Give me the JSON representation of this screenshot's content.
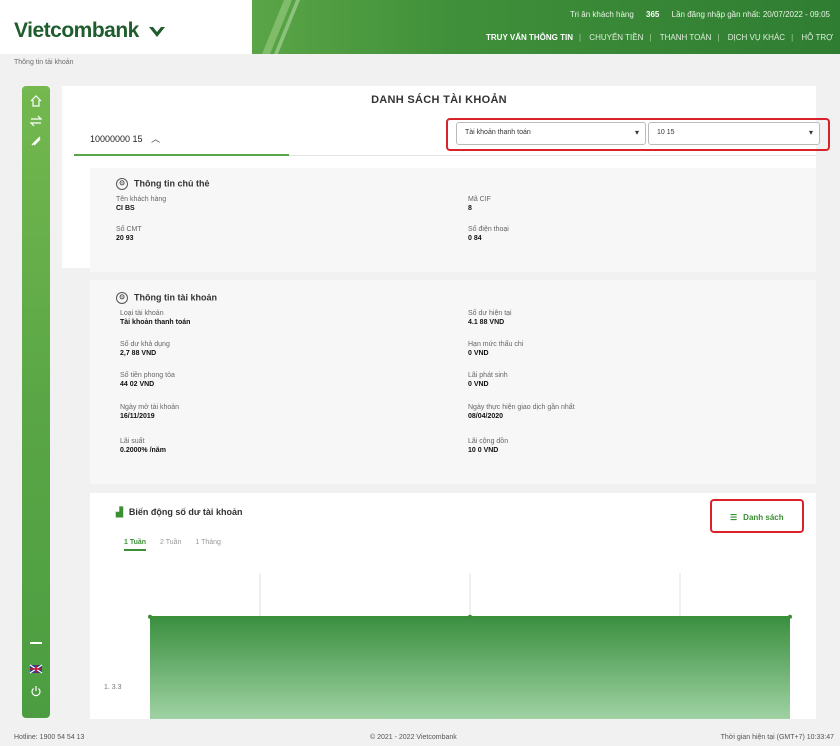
{
  "brand": {
    "name": "Vietcombank",
    "color": "#1f5d2e",
    "accent": "#5aa546"
  },
  "top_info": {
    "greeting": "Tri ân khách hàng",
    "count": "365",
    "last_login_label": "Lần đăng nhập gần nhất: 20/07/2022 - 09:05"
  },
  "nav": {
    "items": [
      "TRUY VẤN THÔNG TIN",
      "CHUYỂN TIỀN",
      "THANH TOÁN",
      "DỊCH VỤ KHÁC",
      "HỖ TRỢ"
    ]
  },
  "breadcrumb": "Thông tin tài khoản",
  "page": {
    "title": "DANH SÁCH TÀI KHOẢN",
    "account_number": "10000000 15",
    "select_type": "Tài khoản thanh toán",
    "select_account": "10          15"
  },
  "owner": {
    "heading": "Thông tin chủ thẻ",
    "name_label": "Tên khách hàng",
    "name_value": "CI              BS",
    "cif_label": "Mã CIF",
    "cif_value": "8",
    "id_label": "Số CMT",
    "id_value": "20        93",
    "phone_label": "Số điện thoại",
    "phone_value": "0          84"
  },
  "account": {
    "heading": "Thông tin tài khoản",
    "type_label": "Loại tài khoản",
    "type_value": "Tài khoản thanh toán",
    "balance_label": "Số dư hiện tại",
    "balance_value": "4.1        88 VND",
    "avail_label": "Số dư khả dụng",
    "avail_value": "2,7        88 VND",
    "limit_label": "Hạn mức thấu chi",
    "limit_value": "0 VND",
    "blocked_label": "Số tiền phong tỏa",
    "blocked_value": "44      02 VND",
    "hold_label": "Lãi phát sinh",
    "hold_value": "0 VND",
    "open_label": "Ngày mở tài khoản",
    "open_value": "16/11/2019",
    "last_txn_label": "Ngày thực hiện giao dịch gần nhất",
    "last_txn_value": "08/04/2020",
    "rate_label": "Lãi suất",
    "rate_value": "0.2000% /năm",
    "accrued_label": "Lãi cộng dồn",
    "accrued_value": "10        0 VND"
  },
  "chart": {
    "heading": "Biến động số dư tài khoản",
    "list_button": "Danh sách",
    "tabs": [
      "1 Tuần",
      "2 Tuần",
      "1 Tháng"
    ],
    "y_label": "1. 3.3"
  },
  "chart_data": {
    "type": "area",
    "x": [
      0,
      1,
      2,
      3,
      4
    ],
    "series": [
      {
        "values": [
          3.3,
          3.3,
          3.3,
          3.3,
          3.3
        ]
      }
    ],
    "grid": true
  },
  "footer": {
    "hotline": "Hotline: 1900 54 54 13",
    "copyright": "© 2021 - 2022 Vietcombank",
    "time": "Thời gian hiện tại (GMT+7) 10:33:47"
  }
}
